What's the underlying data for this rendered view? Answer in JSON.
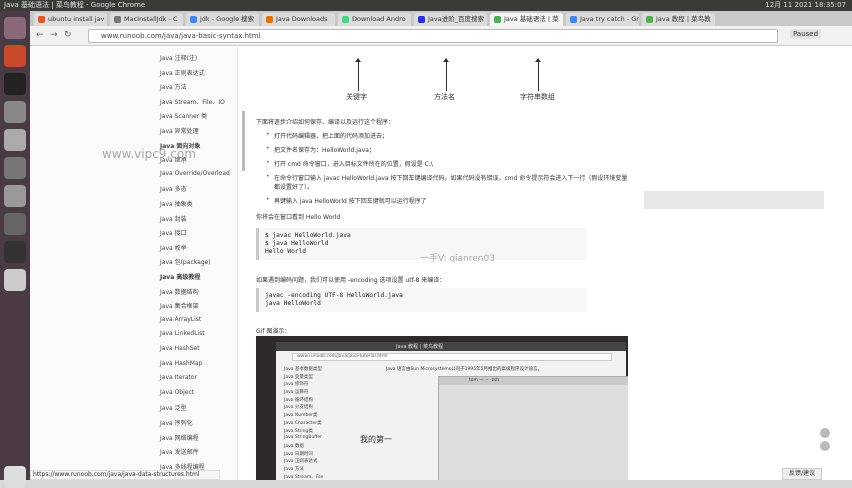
{
  "window": {
    "title": "Java 基础语法 | 菜鸟教程 - Google Chrome",
    "clock": "12月 11 2021  18:35:07"
  },
  "tabs": [
    {
      "label": "ubuntu install jav",
      "color": "#e95420"
    },
    {
      "label": "MacInstallJdk - C",
      "color": "#777777"
    },
    {
      "label": "jdk - Google 搜索",
      "color": "#4285f4"
    },
    {
      "label": "Java Downloads",
      "color": "#e76f00"
    },
    {
      "label": "Download Andro",
      "color": "#3ddc84"
    },
    {
      "label": "Java进阶_百度搜索",
      "color": "#2932e1"
    },
    {
      "label": "Java 基础语法 | 菜",
      "color": "#4caf50"
    },
    {
      "label": "Java try catch - Gn",
      "color": "#4285f4"
    },
    {
      "label": "Java 教程 | 菜鸟教",
      "color": "#4caf50"
    }
  ],
  "address": {
    "url": "www.runoob.com/java/java-basic-syntax.html",
    "paused": "Paused"
  },
  "sidebar": {
    "items": [
      "Java 注释(注)",
      "Java 正则表达式",
      "Java 方法",
      "Java Stream、File、IO",
      "Java Scanner 类",
      "Java 异常处理",
      "Java 面向对象",
      "Java 继承",
      "Java Override/Overload",
      "Java 多态",
      "Java 抽象类",
      "Java 封装",
      "Java 接口",
      "Java 枚举",
      "Java 包(package)",
      "Java 高级教程",
      "Java 数据结构",
      "Java 集合框架",
      "Java ArrayList",
      "Java LinkedList",
      "Java HashSet",
      "Java HashMap",
      "Java Iterator",
      "Java Object",
      "Java 泛型",
      "Java 序列化",
      "Java 网络编程",
      "Java 发送邮件",
      "Java 多线程编程"
    ]
  },
  "content": {
    "labels": [
      "关键字",
      "方法名",
      "字符串数组"
    ],
    "intro": "下面将逐步介绍如何保存、编译以及运行这个程序：",
    "steps": [
      "打开代码编辑器，把上面的代码添加进去；",
      "把文件名保存为：HelloWorld.java；",
      "打开 cmd 命令窗口，进入目标文件所在的位置，假设是 C:\\",
      "在命令行窗口输入 javac HelloWorld.java 按下回车键编译代码。如果代码没有错误，cmd 命令提示符会进入下一行（假设环境变量",
      "都设置好了）。",
      "再键输入 java HelloWorld 按下回车键就可以运行程序了"
    ],
    "output_note": "你将会在窗口看到 Hello World",
    "code1": [
      "$ javac HelloWorld.java",
      "$ java HelloWorld",
      "Hello World"
    ],
    "encoding_note": "如果遇到编码问题，我们可以使用 -encoding 选项设置 utf-8 来编译：",
    "code2": [
      "javac -encoding UTF-8 HelloWorld.java",
      "java HelloWorld"
    ],
    "gif_label": "Gif 图演示：",
    "gif": {
      "window_title": "Java 教程 | 菜鸟教程",
      "url": "www.runoob.com/java/java-tutorial.html",
      "side": [
        "Java 基本数据类型",
        "Java 变量类型",
        "Java 修饰符",
        "Java 运算符",
        "Java 循环结构",
        "Java 分支结构",
        "Java Number类",
        "Java Character类",
        "Java String类",
        "Java StringBuffer",
        "Java 数组",
        "Java 日期时间",
        "Java 正则表达式",
        "Java 方法",
        "Java Stream、File"
      ],
      "mid": "我的第一",
      "desc": "Java 语言由Sun Microsystems公司于1995年5月推出的高级程序设计语言。",
      "term": "tom — -- -zsh"
    }
  },
  "watermarks": [
    "www.vipc9.com",
    "一手V: qianren03"
  ],
  "feedback": "反馈/建议",
  "status_url": "https://www.runoob.com/java/java-data-structures.html"
}
